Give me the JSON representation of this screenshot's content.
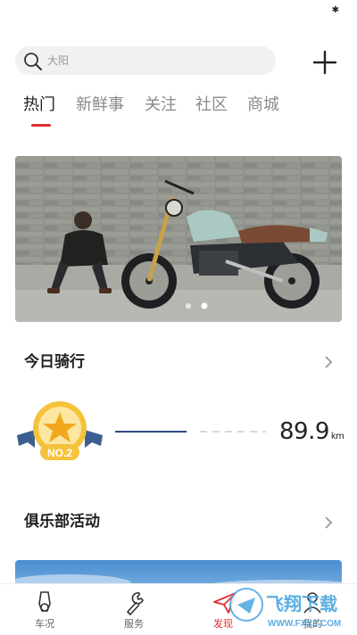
{
  "status_bar": {
    "bluetooth_icon": "bluetooth-icon"
  },
  "search": {
    "placeholder": "大阳",
    "icon": "search-icon"
  },
  "header": {
    "add_icon": "plus-icon"
  },
  "tabs": [
    {
      "label": "热门",
      "active": true
    },
    {
      "label": "新鲜事",
      "active": false
    },
    {
      "label": "关注",
      "active": false
    },
    {
      "label": "社区",
      "active": false
    },
    {
      "label": "商城",
      "active": false
    }
  ],
  "banner": {
    "pages": 2,
    "current_page": 2
  },
  "today_ride": {
    "title": "今日骑行",
    "rank_badge": "NO.2",
    "distance": "89.9",
    "unit": "km",
    "progress_fraction": 0.52
  },
  "club": {
    "title": "俱乐部活动"
  },
  "tabbar": [
    {
      "label": "车况",
      "icon": "scooter-icon",
      "active": false
    },
    {
      "label": "服务",
      "icon": "wrench-icon",
      "active": false
    },
    {
      "label": "发现",
      "icon": "paper-plane-icon",
      "active": true
    },
    {
      "label": "我的",
      "icon": "user-icon",
      "active": false
    }
  ],
  "watermark": {
    "text": "飞翔下载",
    "url": "WWW.FXXZ.COM"
  },
  "colors": {
    "accent": "#e02c2c",
    "progress": "#2d4c86",
    "medal_gold": "#f5c23b",
    "ribbon": "#3d5f8f"
  }
}
